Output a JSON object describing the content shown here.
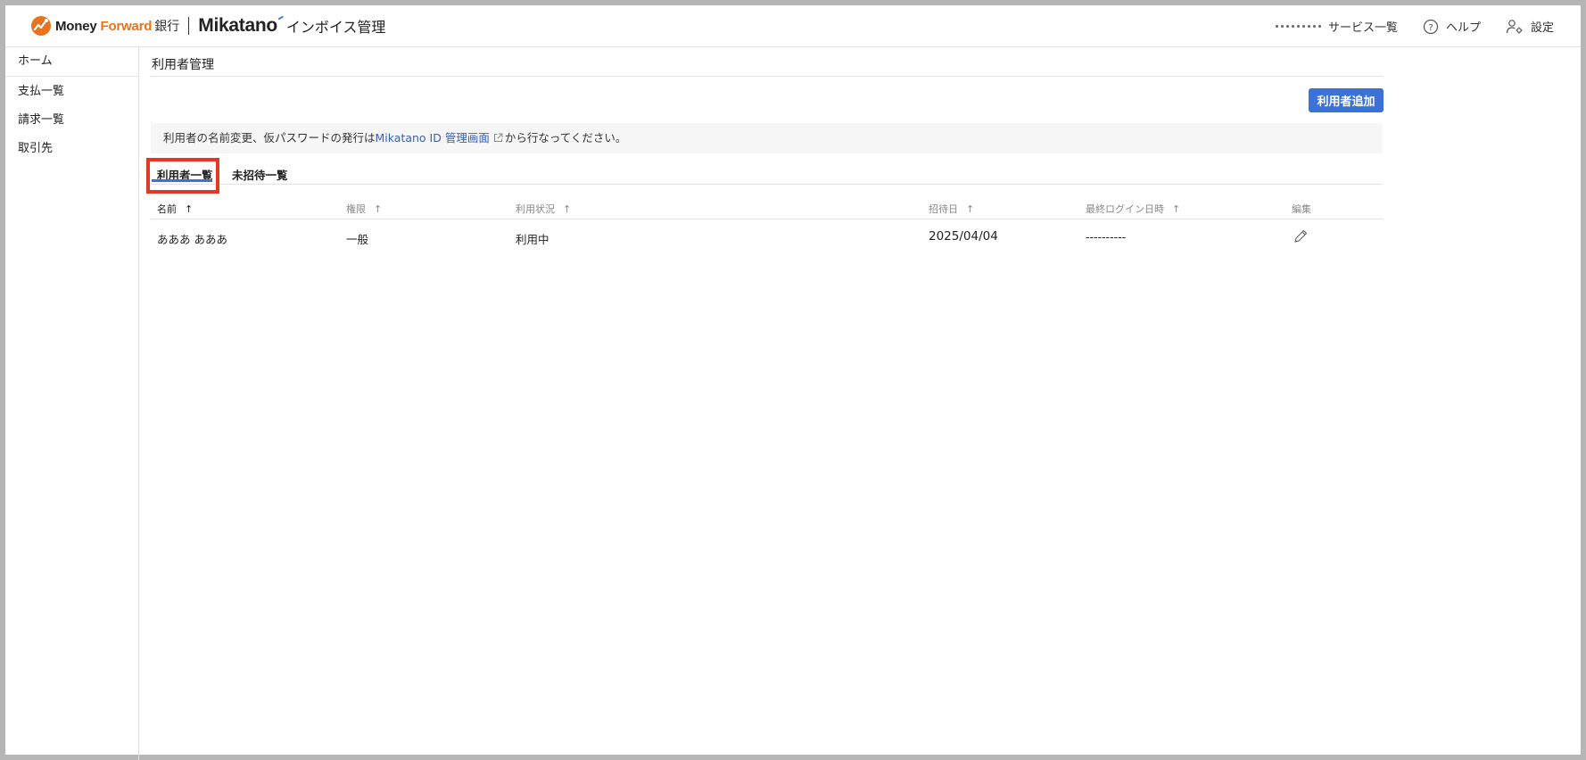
{
  "header": {
    "brand_money": "Money ",
    "brand_forward": "Forward",
    "brand_bank": "銀行",
    "brand_mikatano": "Mikatano",
    "brand_product": "インボイス管理",
    "services_label": "サービス一覧",
    "help_label": "ヘルプ",
    "settings_label": "設定"
  },
  "sidebar": {
    "items": [
      {
        "label": "ホーム"
      },
      {
        "label": "支払一覧"
      },
      {
        "label": "請求一覧"
      },
      {
        "label": "取引先"
      }
    ]
  },
  "main": {
    "page_title": "利用者管理",
    "add_button": "利用者追加",
    "notice_before": "利用者の名前変更、仮パスワードの発行は",
    "notice_link": "Mikatano ID 管理画面",
    "notice_after": "から行なってください。",
    "tabs": [
      {
        "label": "利用者一覧",
        "active": true
      },
      {
        "label": "未招待一覧",
        "active": false
      }
    ],
    "columns": [
      {
        "label": "名前"
      },
      {
        "label": "権限"
      },
      {
        "label": "利用状況"
      },
      {
        "label": "招待日"
      },
      {
        "label": "最終ログイン日時"
      },
      {
        "label": "編集"
      }
    ],
    "rows": [
      {
        "name": "あああ あああ",
        "role": "一般",
        "status": "利用中",
        "invited": "2025/04/04",
        "last_login": "----------"
      }
    ]
  },
  "colors": {
    "accent": "#3a72d8",
    "brand_orange": "#e8731c",
    "highlight": "#e23a22",
    "link": "#3a60b8"
  },
  "icons": {
    "sort": "arrow-up-icon",
    "edit": "pencil-icon",
    "services": "grid-icon",
    "help": "question-circle-icon",
    "settings": "user-gear-icon",
    "external": "external-link-icon"
  }
}
